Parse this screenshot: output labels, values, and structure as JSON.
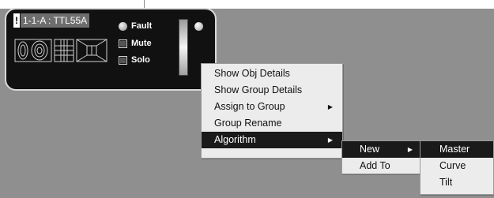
{
  "device": {
    "warning_mark": "!",
    "title": "1-1-A : TTL55A",
    "status": {
      "fault_label": "Fault",
      "mute_label": "Mute",
      "solo_label": "Solo"
    }
  },
  "context_menu": {
    "items": [
      {
        "label": "Show Obj Details",
        "has_submenu": false
      },
      {
        "label": "Show Group Details",
        "has_submenu": false
      },
      {
        "label": "Assign to Group",
        "has_submenu": true
      },
      {
        "label": "Group Rename",
        "has_submenu": false
      },
      {
        "label": "Algorithm",
        "has_submenu": true,
        "active": true
      }
    ]
  },
  "algorithm_submenu": {
    "items": [
      {
        "label": "New",
        "has_submenu": true,
        "active": true
      },
      {
        "label": "Add To",
        "has_submenu": false
      }
    ]
  },
  "new_submenu": {
    "items": [
      {
        "label": "Master",
        "active": true
      },
      {
        "label": "Curve"
      },
      {
        "label": "Tilt"
      }
    ]
  },
  "colors": {
    "background": "#8f8f8f",
    "menu_background": "#ececec",
    "menu_highlight": "#1a1a1a",
    "tile_background": "#111111"
  }
}
